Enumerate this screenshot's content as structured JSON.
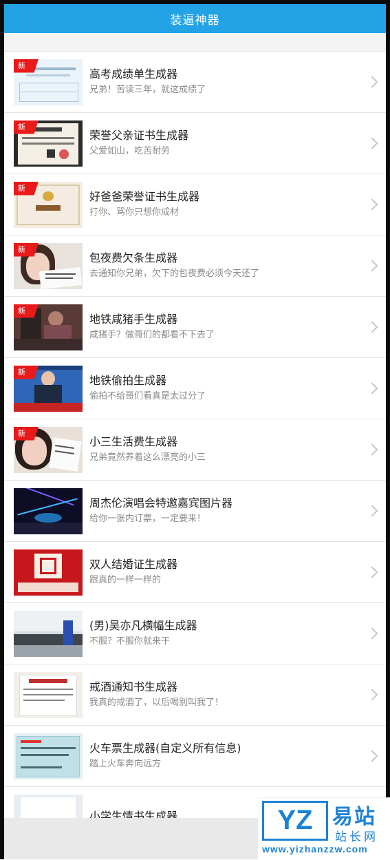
{
  "header": {
    "title": "装逼神器"
  },
  "badge_label": "新",
  "items": [
    {
      "title": "高考成绩单生成器",
      "subtitle": "兄弟！苦读三年，就这成绩了",
      "new": true,
      "thumb": "exam-report-thumb"
    },
    {
      "title": "荣誉父亲证书生成器",
      "subtitle": "父爱如山，吃苦耐劳",
      "new": true,
      "thumb": "certificate-thumb"
    },
    {
      "title": "好爸爸荣誉证书生成器",
      "subtitle": "打你、骂你只想你成材",
      "new": true,
      "thumb": "honor-certificate-thumb"
    },
    {
      "title": "包夜费欠条生成器",
      "subtitle": "去通知你兄弟，欠下的包夜费必须今天还了",
      "new": true,
      "thumb": "girl-note-thumb"
    },
    {
      "title": "地铁咸猪手生成器",
      "subtitle": "咸猪手？做哥们的都看不下去了",
      "new": true,
      "thumb": "subway-thumb"
    },
    {
      "title": "地铁偷拍生成器",
      "subtitle": "偷拍不给哥们看真是太过分了",
      "new": true,
      "thumb": "news-anchor-thumb"
    },
    {
      "title": "小三生活费生成器",
      "subtitle": "兄弟竟然养着这么漂亮的小三",
      "new": true,
      "thumb": "girl-card-thumb"
    },
    {
      "title": "周杰伦演唱会特邀嘉宾图片器",
      "subtitle": "给你一张内订票，一定要来！",
      "new": false,
      "thumb": "concert-thumb"
    },
    {
      "title": "双人结婚证生成器",
      "subtitle": "跟真的一样一样的",
      "new": false,
      "thumb": "marriage-thumb"
    },
    {
      "title": "(男)吴亦凡横幅生成器",
      "subtitle": "不服？不服你就来干",
      "new": false,
      "thumb": "banner-thumb"
    },
    {
      "title": "戒酒通知书生成器",
      "subtitle": "我真的戒酒了，以后喝别叫我了！",
      "new": false,
      "thumb": "notice-thumb"
    },
    {
      "title": "火车票生成器(自定义所有信息)",
      "subtitle": "踏上火车奔向远方",
      "new": false,
      "thumb": "train-ticket-thumb"
    },
    {
      "title": "小学生情书生成器",
      "subtitle": "",
      "new": false,
      "thumb": "letter-thumb"
    }
  ],
  "watermark": {
    "logo": "YZ",
    "big": "易站",
    "small": "站长网",
    "url": "www.yizhanzzw.com"
  },
  "colors": {
    "header": "#23a3e6",
    "badge": "#e81a1a",
    "watermark": "#1c82d6"
  }
}
